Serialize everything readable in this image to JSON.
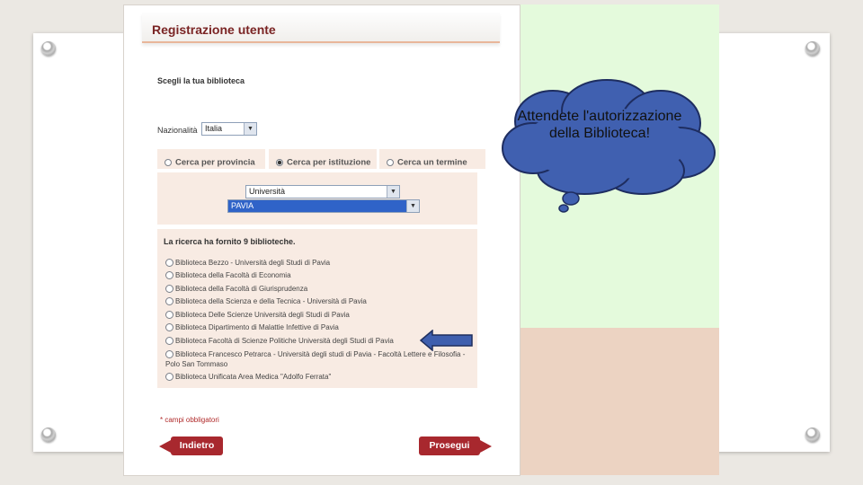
{
  "page_title": "Registrazione utente",
  "choose_library_label": "Scegli la tua biblioteca",
  "nationality": {
    "label": "Nazionalità",
    "value": "Italia"
  },
  "search_tabs": [
    {
      "label": "Cerca per provincia",
      "selected": false
    },
    {
      "label": "Cerca per istituzione",
      "selected": true
    },
    {
      "label": "Cerca un termine",
      "selected": false
    }
  ],
  "institution_type": {
    "value": "Università"
  },
  "institution": {
    "value": "PAVIA"
  },
  "results_heading": "La ricerca ha fornito 9 biblioteche.",
  "results": [
    "Biblioteca Bezzo - Università degli Studi di Pavia",
    "Biblioteca della Facoltà di Economia",
    "Biblioteca della Facoltà di Giurisprudenza",
    "Biblioteca della Scienza e della Tecnica - Università di Pavia",
    "Biblioteca Delle Scienze Università degli Studi di Pavia",
    "Biblioteca Dipartimento di Malattie Infettive di Pavia",
    "Biblioteca Facoltà di Scienze Politiche Università degli Studi di Pavia",
    "Biblioteca Francesco Petrarca - Università degli studi di Pavia - Facoltà Lettere e Filosofia - Polo San Tommaso",
    "Biblioteca Unificata Area Medica \"Adolfo Ferrata\""
  ],
  "required_note": "* campi obbligatori",
  "back_button": "Indietro",
  "next_button": "Prosegui",
  "callout_text": "Attendete l'autorizzazione della Biblioteca!",
  "colors": {
    "accent": "#a8282e",
    "cloud": "#4060b0",
    "green_panel": "#e4fadc",
    "peach_panel": "#ecd3c2"
  }
}
